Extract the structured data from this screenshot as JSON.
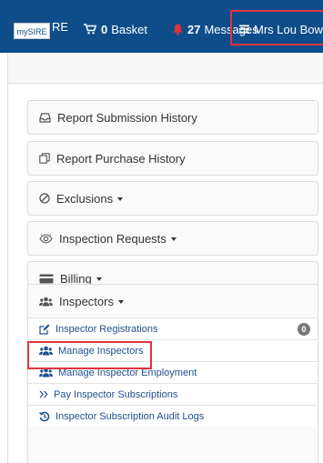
{
  "navbar": {
    "brand_box": "mySIRE",
    "brand_rest": "RE",
    "basket_count": "0",
    "basket_label": "Basket",
    "messages_count": "27",
    "messages_label": "Messages",
    "user_label": "Mrs Lou Bowen"
  },
  "menu": {
    "report_submission": "Report Submission History",
    "report_purchase": "Report Purchase History",
    "exclusions": "Exclusions",
    "inspection_requests": "Inspection Requests",
    "billing": "Billing",
    "inspectors": "Inspectors",
    "inspectors_items": [
      {
        "label": "Inspector Registrations",
        "badge": "0"
      },
      {
        "label": "Manage Inspectors"
      },
      {
        "label": "Manage Inspector Employment"
      },
      {
        "label": "Pay Inspector Subscriptions"
      },
      {
        "label": "Inspector Subscription Audit Logs"
      }
    ]
  },
  "colors": {
    "navbar_bg": "#0e4d8a",
    "highlight": "#e0343c",
    "link": "#1f4f8f",
    "bell": "#e0343c"
  }
}
